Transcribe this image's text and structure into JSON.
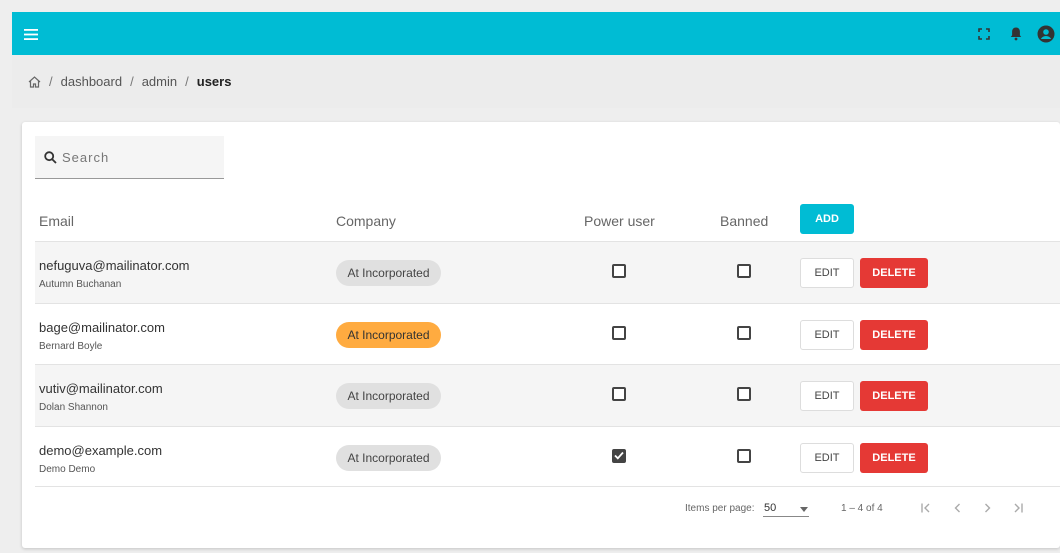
{
  "topbar": {
    "menu_icon": "menu-icon",
    "right_icons": [
      "fullscreen-icon",
      "bell-icon",
      "account-icon"
    ],
    "color": "#00bcd4"
  },
  "breadcrumb": {
    "home_icon": "home-icon",
    "items": [
      "dashboard",
      "admin"
    ],
    "current": "users",
    "separator": "/"
  },
  "search": {
    "placeholder": "Search",
    "value": ""
  },
  "table": {
    "columns": {
      "email": "Email",
      "company": "Company",
      "power_user": "Power user",
      "banned": "Banned"
    },
    "add_label": "ADD",
    "edit_label": "EDIT",
    "delete_label": "DELETE",
    "rows": [
      {
        "email": "nefuguva@mailinator.com",
        "name": "Autumn Buchanan",
        "company": "At Incorporated",
        "company_highlight": false,
        "power_user": false,
        "banned": false
      },
      {
        "email": "bage@mailinator.com",
        "name": "Bernard Boyle",
        "company": "At Incorporated",
        "company_highlight": true,
        "power_user": false,
        "banned": false
      },
      {
        "email": "vutiv@mailinator.com",
        "name": "Dolan Shannon",
        "company": "At Incorporated",
        "company_highlight": false,
        "power_user": false,
        "banned": false
      },
      {
        "email": "demo@example.com",
        "name": "Demo Demo",
        "company": "At Incorporated",
        "company_highlight": false,
        "power_user": true,
        "banned": false
      }
    ]
  },
  "paginator": {
    "items_per_page_label": "Items per page:",
    "page_size": "50",
    "range": "1 – 4 of 4"
  },
  "colors": {
    "accent": "#00bcd4",
    "delete": "#e53935",
    "highlight_chip": "#ffab40"
  }
}
